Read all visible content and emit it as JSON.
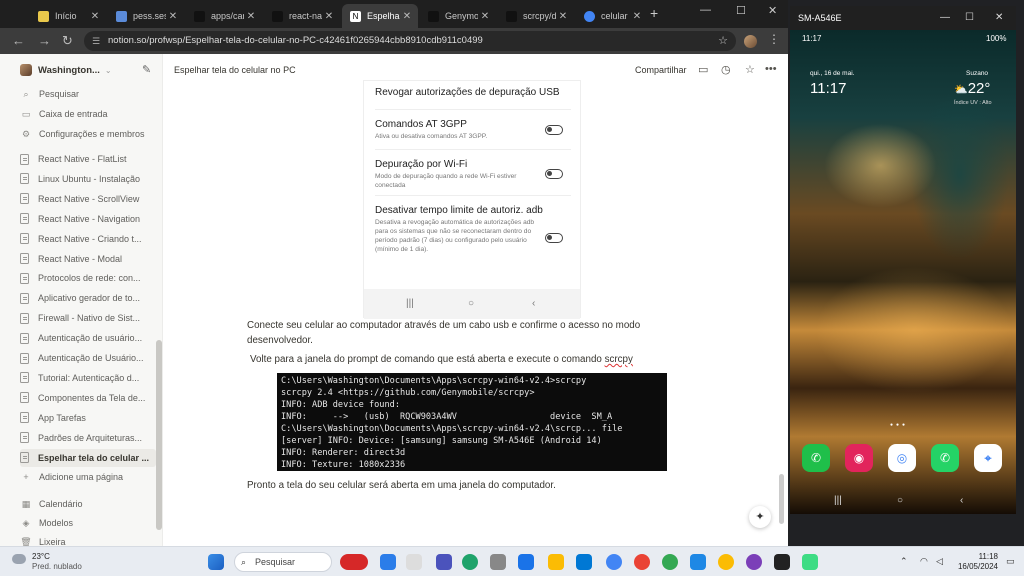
{
  "browser": {
    "tabs": [
      {
        "label": "Início",
        "color": "#e9c84b"
      },
      {
        "label": "pess.ses",
        "color": "#5b8bd9"
      },
      {
        "label": "apps/can",
        "color": "#222222"
      },
      {
        "label": "react-nat",
        "color": "#222222"
      },
      {
        "label": "Espelhar",
        "color": "#ffffff"
      },
      {
        "label": "Genymob",
        "color": "#222222"
      },
      {
        "label": "scrcpy/d",
        "color": "#222222"
      },
      {
        "label": "celular n",
        "color": "#4285f4"
      }
    ],
    "url": "notion.so/profwsp/Espelhar-tela-do-celular-no-PC-c42461f0265944cbb8910cdb911c0499"
  },
  "sidebar": {
    "workspace": "Washington...",
    "top_items": [
      {
        "label": "Pesquisar",
        "icon": "⌕"
      },
      {
        "label": "Caixa de entrada",
        "icon": "▭"
      },
      {
        "label": "Configurações e membros",
        "icon": "⚙"
      }
    ],
    "pages": [
      "React Native - FlatList",
      "Linux Ubuntu - Instalação",
      "React Native - ScrollView",
      "React Native - Navigation",
      "React Native - Criando t...",
      "React Native - Modal",
      "Protocolos de rede: con...",
      "Aplicativo gerador de to...",
      "Firewall - Nativo de Sist...",
      "Autenticação de usuário...",
      "Autenticação de Usuário...",
      "Tutorial: Autenticação d...",
      "Componentes da Tela de...",
      "App Tarefas",
      "Padrões de Arquiteturas...",
      "Espelhar tela do celular ..."
    ],
    "add_page": "Adicione uma página",
    "bottom_items": [
      {
        "label": "Calendário",
        "icon": "▦"
      },
      {
        "label": "Modelos",
        "icon": "◈"
      },
      {
        "label": "Lixeira",
        "icon": "🗑"
      }
    ]
  },
  "main": {
    "breadcrumb": "Espelhar tela do celular no PC",
    "share": "Compartilhar",
    "phone_settings": {
      "header": "Revogar autorizações de depuração USB",
      "items": [
        {
          "title": "Comandos AT 3GPP",
          "desc": "Ativa ou desativa comandos AT 3GPP."
        },
        {
          "title": "Depuração por Wi-Fi",
          "desc": "Modo de depuração quando a rede Wi-Fi estiver conectada"
        },
        {
          "title": "Desativar tempo limite de autoriz. adb",
          "desc": "Desativa a revogação automática de autorizações adb para os sistemas que não se reconectaram dentro do período padrão (7 dias) ou configurado pelo usuário (mínimo de 1 dia)."
        }
      ]
    },
    "para1": "Conecte seu celular ao computador através de um cabo usb e confirme o acesso no modo desenvolvedor.",
    "para2_prefix": "Volte para a janela do prompt de comando que está aberta e execute o comando ",
    "para2_cmd": "scrcpy",
    "terminal_lines": [
      "C:\\Users\\Washington\\Documents\\Apps\\scrcpy-win64-v2.4>scrcpy",
      "scrcpy 2.4 <https://github.com/Genymobile/scrcpy>",
      "INFO: ADB device found:",
      "INFO:     -->   (usb)  RQCW903A4WV                  device  SM_A",
      "C:\\Users\\Washington\\Documents\\Apps\\scrcpy-win64-v2.4\\scrcp... file",
      "[server] INFO: Device: [samsung] samsung SM-A546E (Android 14)",
      "INFO: Renderer: direct3d",
      "INFO: Texture: 1080x2336"
    ],
    "para3": "Pronto a tela do seu celular será aberta em uma janela do computador."
  },
  "mirror": {
    "title": "SM-A546E",
    "status_time": "11:17",
    "status_right": "100%",
    "date": "qui., 16 de mai.",
    "clock": "11:17",
    "location": "Suzano",
    "temperature": "22°",
    "uv": "Índice UV : Alto"
  },
  "taskbar": {
    "weather_temp": "23°C",
    "weather_desc": "Pred. nublado",
    "search": "Pesquisar",
    "time": "11:18",
    "date": "16/05/2024"
  }
}
